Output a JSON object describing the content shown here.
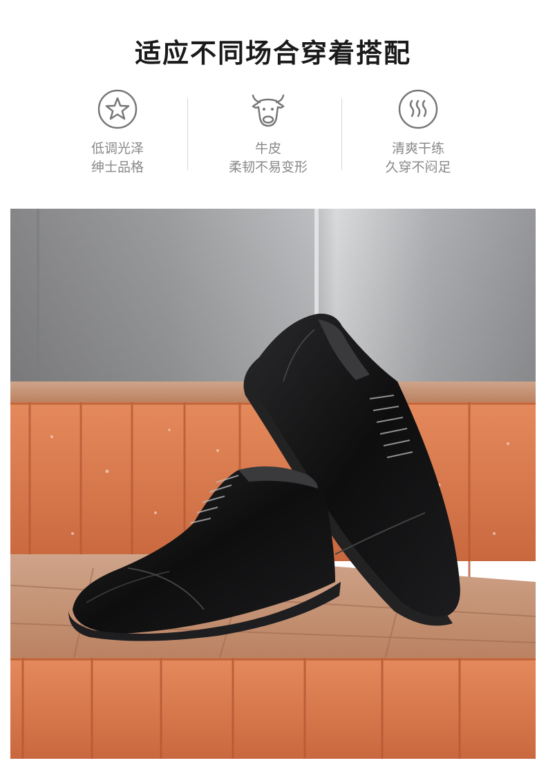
{
  "header": {
    "title": "适应不同场合穿着搭配"
  },
  "features": [
    {
      "icon": "star-badge-icon",
      "line1": "低调光泽",
      "line2": "绅士品格"
    },
    {
      "icon": "cow-head-icon",
      "line1": "牛皮",
      "line2": "柔韧不易变形"
    },
    {
      "icon": "steam-vent-icon",
      "line1": "清爽干练",
      "line2": "久穿不闷足"
    }
  ],
  "colors": {
    "text_dark": "#1a1a1a",
    "text_muted": "#888888",
    "brick": "#d9784f",
    "leather": "#111111"
  }
}
